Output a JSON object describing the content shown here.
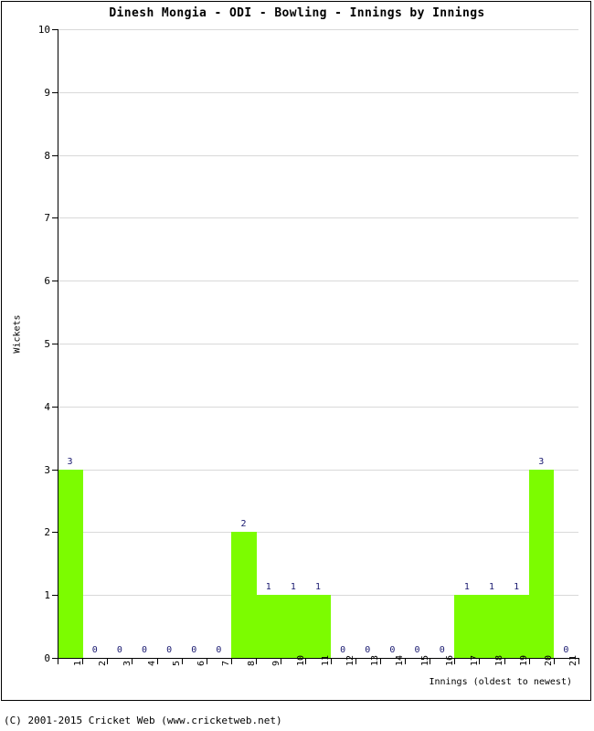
{
  "chart_data": {
    "type": "bar",
    "title": "Dinesh Mongia - ODI - Bowling - Innings by Innings",
    "xlabel": "Innings (oldest to newest)",
    "ylabel": "Wickets",
    "ylim": [
      0,
      10
    ],
    "ytick_labels": [
      "10",
      "9",
      "8",
      "7",
      "6",
      "5",
      "4",
      "3",
      "2",
      "1",
      "0"
    ],
    "yticks": [
      10,
      9,
      8,
      7,
      6,
      5,
      4,
      3,
      2,
      1,
      0
    ],
    "grid": true,
    "grid_axis": "y",
    "legend": null,
    "categories": [
      "1",
      "2",
      "3",
      "4",
      "5",
      "6",
      "7",
      "8",
      "9",
      "10",
      "11",
      "12",
      "13",
      "14",
      "15",
      "16",
      "17",
      "18",
      "19",
      "20",
      "21"
    ],
    "values": [
      3,
      0,
      0,
      0,
      0,
      0,
      0,
      2,
      1,
      1,
      1,
      0,
      0,
      0,
      0,
      0,
      1,
      1,
      1,
      3,
      0
    ],
    "data_labels": [
      "3",
      "0",
      "0",
      "0",
      "0",
      "0",
      "0",
      "2",
      "1",
      "1",
      "1",
      "0",
      "0",
      "0",
      "0",
      "0",
      "1",
      "1",
      "1",
      "3",
      "0"
    ],
    "bar_color": "#7CFC00",
    "data_label_color": "#191970",
    "grid_color": "#D9D9D9",
    "axis_color": "#000000"
  },
  "footer": {
    "copyright": "(C) 2001-2015 Cricket Web (www.cricketweb.net)"
  }
}
